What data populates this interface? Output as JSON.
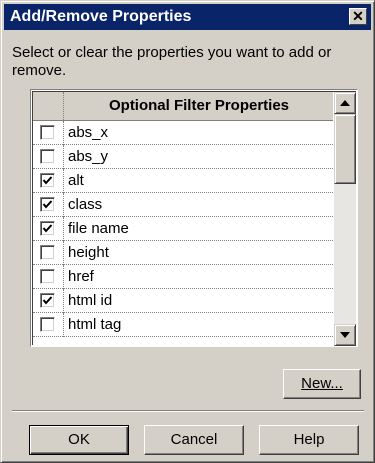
{
  "dialog": {
    "title": "Add/Remove Properties",
    "close_glyph": "✕",
    "instructions": "Select or clear the properties you want to add or remove."
  },
  "list": {
    "header": "Optional Filter Properties",
    "items": [
      {
        "label": "abs_x",
        "checked": false
      },
      {
        "label": "abs_y",
        "checked": false
      },
      {
        "label": "alt",
        "checked": true
      },
      {
        "label": "class",
        "checked": true
      },
      {
        "label": "file name",
        "checked": true
      },
      {
        "label": "height",
        "checked": false
      },
      {
        "label": "href",
        "checked": false
      },
      {
        "label": "html id",
        "checked": true
      },
      {
        "label": "html tag",
        "checked": false
      }
    ]
  },
  "buttons": {
    "new_label": "New...",
    "ok_label": "OK",
    "cancel_label": "Cancel",
    "help_label": "Help"
  },
  "colors": {
    "title_bar": "#0a246a",
    "face": "#d4d0c8"
  }
}
